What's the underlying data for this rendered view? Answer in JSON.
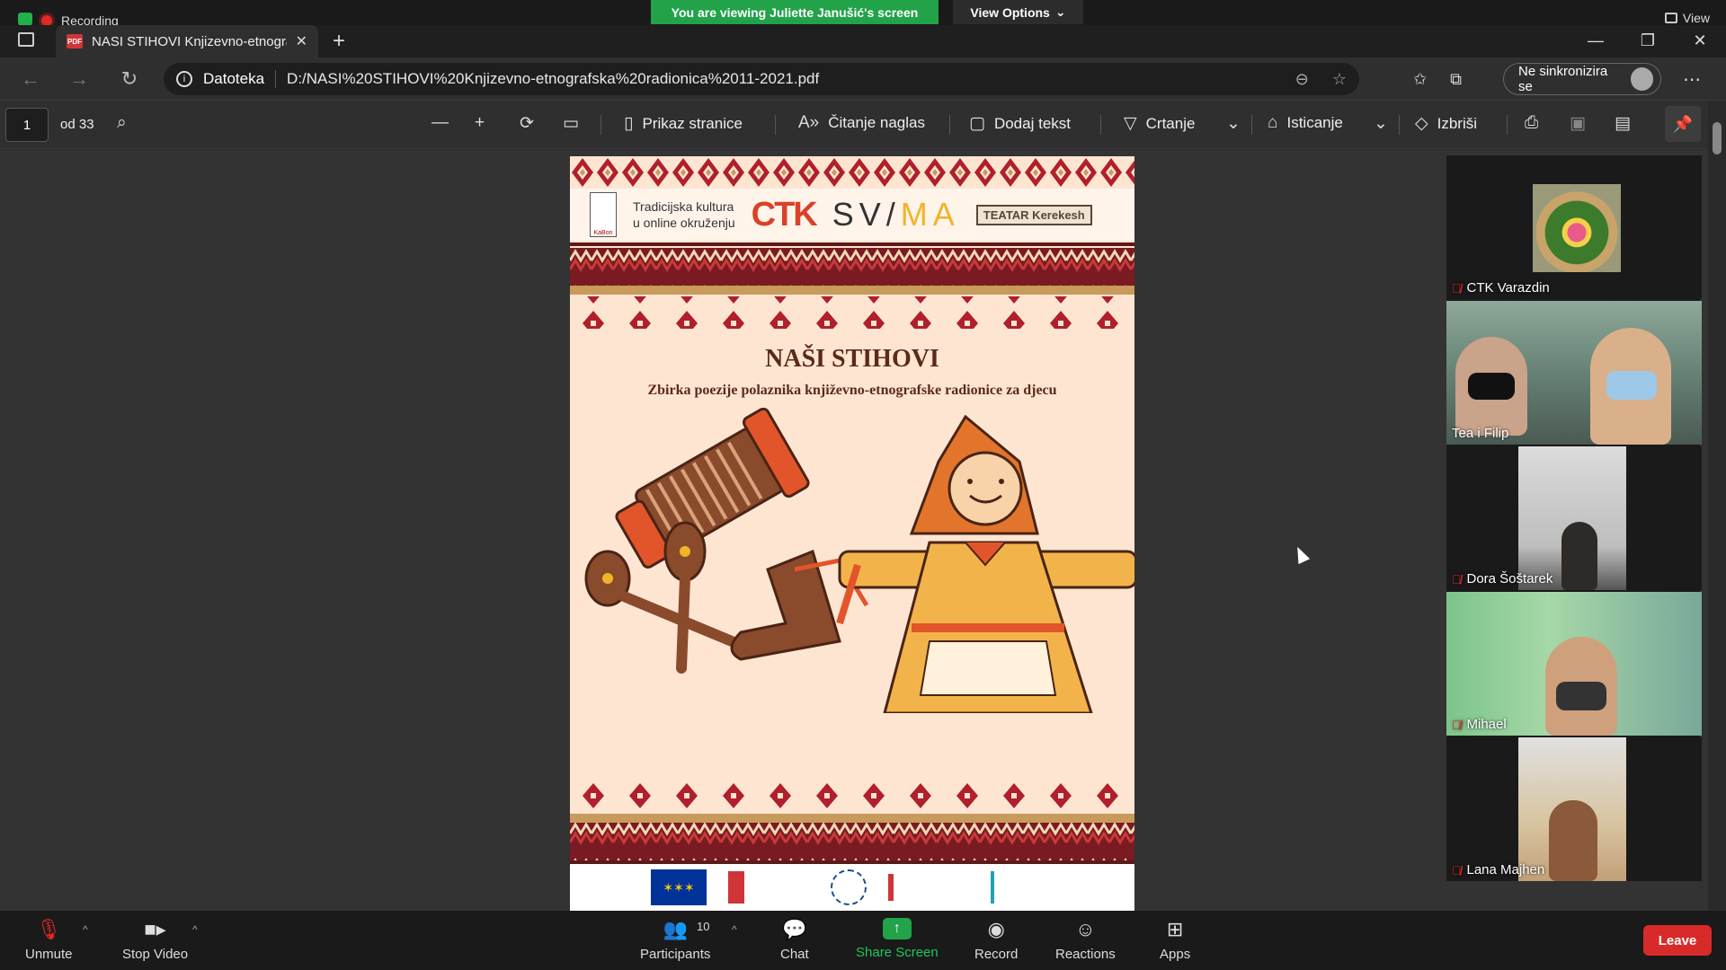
{
  "zoom_top": {
    "recording_label": "Recording",
    "viewing_banner": "You are viewing Juliette Janušić's screen",
    "view_options_label": "View Options",
    "view_label": "View"
  },
  "browser": {
    "tab_title": "NASI STIHOVI Knjizevno-etnogra",
    "address_label": "Datoteka",
    "url": "D:/NASI%20STIHOVI%20Knjizevno-etnografska%20radionica%2011-2021.pdf",
    "sync_label": "Ne sinkronizira se"
  },
  "pdf_toolbar": {
    "page_number": "1",
    "page_total": "od 33",
    "page_view_label": "Prikaz stranice",
    "read_aloud_label": "Čitanje naglas",
    "add_text_label": "Dodaj tekst",
    "draw_label": "Crtanje",
    "highlight_label": "Isticanje",
    "erase_label": "Izbriši"
  },
  "pdf_page": {
    "logo_text_1": "Tradicijska kultura",
    "logo_text_2": "u online okruženju",
    "ctk": "CTK",
    "svima_1": "SV/",
    "svima_2": "MA",
    "kerekesh": "TEATAR Kerekesh",
    "title": "NAŠI STIHOVI",
    "subtitle": "Zbirka poezije polaznika književno-etnografske radionice za djecu"
  },
  "participants": [
    {
      "name": "CTK Varazdin",
      "muted": true
    },
    {
      "name": "Tea i Filip",
      "muted": false
    },
    {
      "name": "Dora Šoštarek",
      "muted": true
    },
    {
      "name": "Mihael",
      "muted": true
    },
    {
      "name": "Lana Majhen",
      "muted": true
    }
  ],
  "zoom_bottom": {
    "unmute": "Unmute",
    "stop_video": "Stop Video",
    "participants": "Participants",
    "participants_count": "10",
    "chat": "Chat",
    "share_screen": "Share Screen",
    "record": "Record",
    "reactions": "Reactions",
    "apps": "Apps",
    "leave": "Leave"
  },
  "colors": {
    "zoom_green": "#22a34a",
    "leave_red": "#d92a2a",
    "page_bg": "#fde5d2",
    "embroidery_red": "#b01f2b"
  }
}
